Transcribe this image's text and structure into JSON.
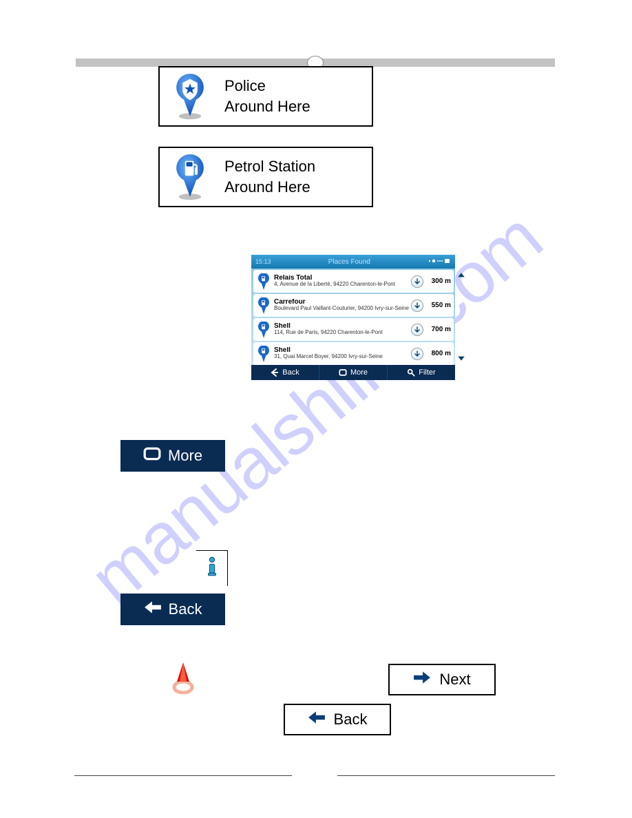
{
  "watermark": "manualshline.com",
  "poi": {
    "police": {
      "line1": "Police",
      "line2": "Around Here"
    },
    "petrol": {
      "line1": "Petrol Station",
      "line2": "Around Here"
    }
  },
  "places": {
    "time": "15:13",
    "title": "Places Found",
    "rows": [
      {
        "name": "Relais Total",
        "addr": "4, Avenue de la Liberté, 94220 Charenton-le-Pont",
        "dist": "300 m"
      },
      {
        "name": "Carrefour",
        "addr": "Boulevard Paul Vaillant-Couturier, 94200 Ivry-sur-Seine",
        "dist": "550 m"
      },
      {
        "name": "Shell",
        "addr": "114, Rue de Paris, 94220 Charenton-le-Pont",
        "dist": "700 m"
      },
      {
        "name": "Shell",
        "addr": "31, Quai Marcel Boyer, 94200 Ivry-sur-Seine",
        "dist": "800 m"
      }
    ],
    "footer": {
      "back": "Back",
      "more": "More",
      "filter": "Filter"
    }
  },
  "buttons": {
    "more": "More",
    "back": "Back",
    "next": "Next"
  }
}
